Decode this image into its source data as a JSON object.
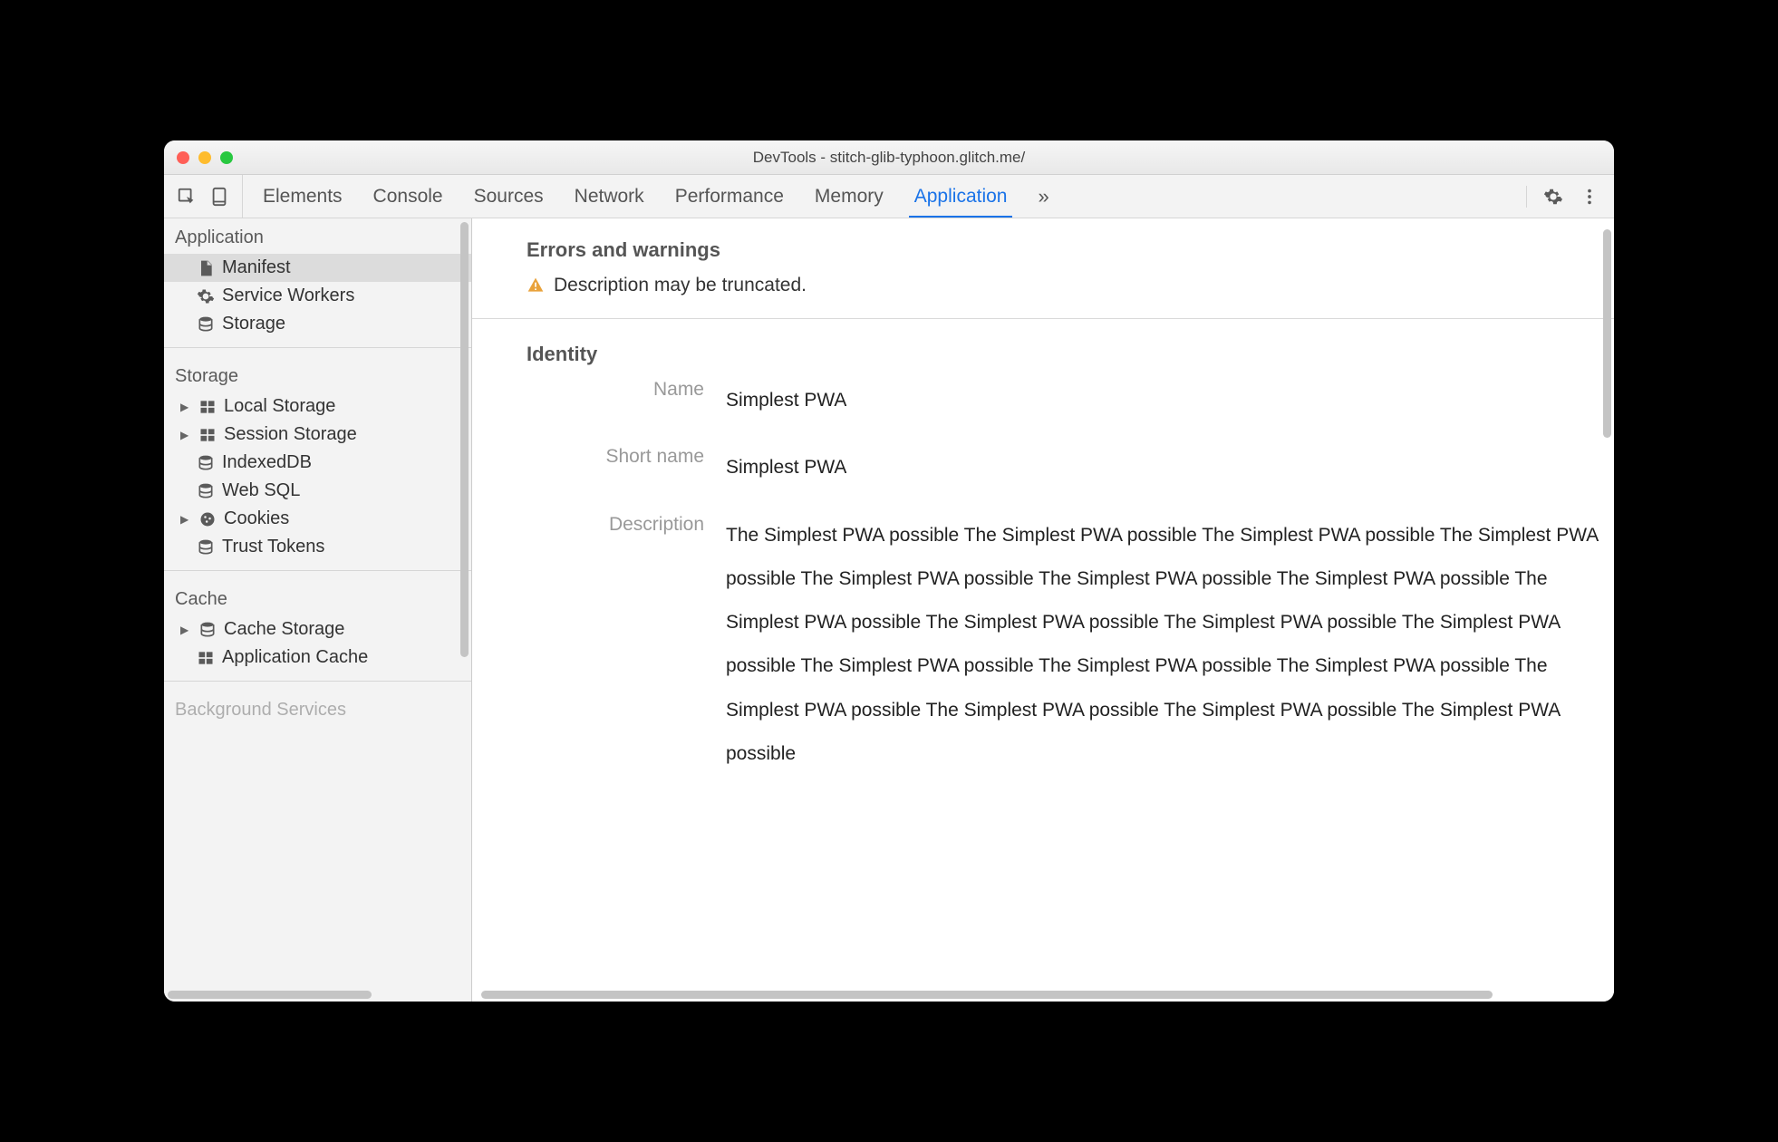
{
  "window_title": "DevTools - stitch-glib-typhoon.glitch.me/",
  "tabs": [
    "Elements",
    "Console",
    "Sources",
    "Network",
    "Performance",
    "Memory",
    "Application"
  ],
  "active_tab": "Application",
  "sidebar": {
    "groups": [
      {
        "title": "Application",
        "items": [
          {
            "label": "Manifest",
            "icon": "file",
            "selected": true
          },
          {
            "label": "Service Workers",
            "icon": "gear"
          },
          {
            "label": "Storage",
            "icon": "db"
          }
        ]
      },
      {
        "title": "Storage",
        "items": [
          {
            "label": "Local Storage",
            "icon": "grid",
            "expandable": true
          },
          {
            "label": "Session Storage",
            "icon": "grid",
            "expandable": true
          },
          {
            "label": "IndexedDB",
            "icon": "db"
          },
          {
            "label": "Web SQL",
            "icon": "db"
          },
          {
            "label": "Cookies",
            "icon": "cookie",
            "expandable": true
          },
          {
            "label": "Trust Tokens",
            "icon": "db"
          }
        ]
      },
      {
        "title": "Cache",
        "items": [
          {
            "label": "Cache Storage",
            "icon": "db",
            "expandable": true
          },
          {
            "label": "Application Cache",
            "icon": "grid"
          }
        ]
      },
      {
        "title": "Background Services",
        "items": []
      }
    ]
  },
  "main": {
    "errors_title": "Errors and warnings",
    "warning_text": "Description may be truncated.",
    "identity_title": "Identity",
    "identity": {
      "name_label": "Name",
      "name_value": "Simplest PWA",
      "short_name_label": "Short name",
      "short_name_value": "Simplest PWA",
      "description_label": "Description",
      "description_value": "The Simplest PWA possible The Simplest PWA possible The Simplest PWA possible The Simplest PWA possible The Simplest PWA possible The Simplest PWA possible The Simplest PWA possible The Simplest PWA possible The Simplest PWA possible The Simplest PWA possible The Simplest PWA possible The Simplest PWA possible The Simplest PWA possible The Simplest PWA possible The Simplest PWA possible The Simplest PWA possible The Simplest PWA possible The Simplest PWA possible"
    }
  }
}
